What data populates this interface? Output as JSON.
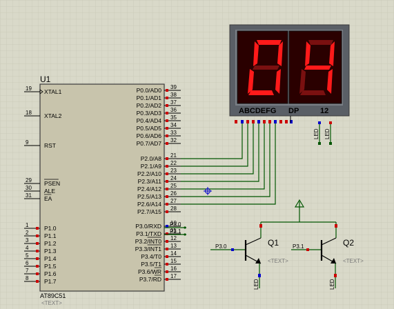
{
  "chip": {
    "ref": "U1",
    "part": "AT89C51",
    "text_placeholder": "<TEXT>",
    "left_pins": [
      {
        "num": "19",
        "name": "XTAL1"
      },
      {
        "num": "18",
        "name": "XTAL2"
      },
      {
        "num": "9",
        "name": "RST"
      },
      {
        "num": "29",
        "name": "PSEN"
      },
      {
        "num": "30",
        "name": "ALE"
      },
      {
        "num": "31",
        "name": "EA"
      },
      {
        "num": "1",
        "name": "P1.0"
      },
      {
        "num": "2",
        "name": "P1.1"
      },
      {
        "num": "3",
        "name": "P1.2"
      },
      {
        "num": "4",
        "name": "P1.3"
      },
      {
        "num": "5",
        "name": "P1.4"
      },
      {
        "num": "6",
        "name": "P1.5"
      },
      {
        "num": "7",
        "name": "P1.6"
      },
      {
        "num": "8",
        "name": "P1.7"
      }
    ],
    "right_pins": [
      {
        "num": "39",
        "name": "P0.0/AD0"
      },
      {
        "num": "38",
        "name": "P0.1/AD1"
      },
      {
        "num": "37",
        "name": "P0.2/AD2"
      },
      {
        "num": "36",
        "name": "P0.3/AD3"
      },
      {
        "num": "35",
        "name": "P0.4/AD4"
      },
      {
        "num": "34",
        "name": "P0.5/AD5"
      },
      {
        "num": "33",
        "name": "P0.6/AD6"
      },
      {
        "num": "32",
        "name": "P0.7/AD7"
      },
      {
        "num": "21",
        "name": "P2.0/A8"
      },
      {
        "num": "22",
        "name": "P2.1/A9"
      },
      {
        "num": "23",
        "name": "P2.2/A10"
      },
      {
        "num": "24",
        "name": "P2.3/A11"
      },
      {
        "num": "25",
        "name": "P2.4/A12"
      },
      {
        "num": "26",
        "name": "P2.5/A13"
      },
      {
        "num": "27",
        "name": "P2.6/A14"
      },
      {
        "num": "28",
        "name": "P2.7/A15"
      },
      {
        "num": "10",
        "name": "P3.0/RXD"
      },
      {
        "num": "11",
        "name": "P3.1/TXD"
      },
      {
        "num": "12",
        "name": "P3.2/INT0"
      },
      {
        "num": "13",
        "name": "P3.3/INT1"
      },
      {
        "num": "14",
        "name": "P3.4/T0"
      },
      {
        "num": "15",
        "name": "P3.5/T1"
      },
      {
        "num": "16",
        "name": "P3.6/WR"
      },
      {
        "num": "17",
        "name": "P3.7/RD"
      }
    ]
  },
  "display": {
    "digits": [
      "0",
      "4"
    ],
    "segment_label": "ABCDEFG",
    "dp_label": "DP",
    "digit_select_label": "12",
    "segment_color": "#ff1a1a",
    "segment_off_color": "#7a1010"
  },
  "net_labels": {
    "p30": "P3.0",
    "p31": "P3.1"
  },
  "transistors": [
    {
      "ref": "Q1",
      "text": "<TEXT>",
      "input_label": "P3.0",
      "led": "LED"
    },
    {
      "ref": "Q2",
      "text": "<TEXT>",
      "input_label": "P3.1",
      "led": "LED"
    }
  ],
  "display_leds": [
    "LED",
    "LED"
  ],
  "colors": {
    "background": "#d9d9c9",
    "grid": "#c8c8b8",
    "wire": "#005500",
    "chip_fill": "#c8c4ac",
    "pin_red": "#cc0000",
    "pin_blue": "#0000cc"
  }
}
